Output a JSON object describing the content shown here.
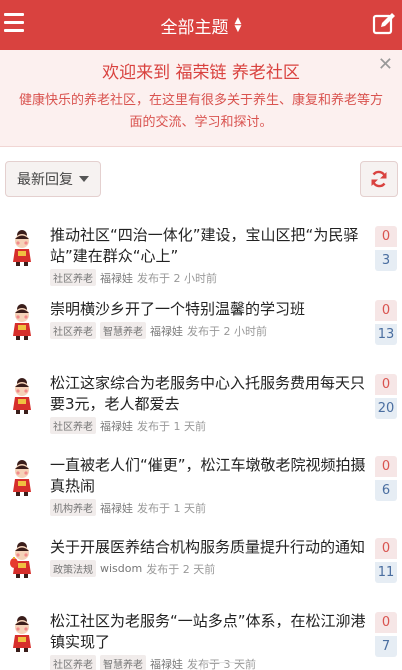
{
  "header": {
    "title": "全部主题"
  },
  "welcome": {
    "heading": "欢迎来到 福荣链 养老社区",
    "description": "健康快乐的养老社区，在这里有很多关于养生、康复和养老等方面的交流、学习和探讨。"
  },
  "toolbar": {
    "sort_label": "最新回复"
  },
  "colors": {
    "brand": "#d9423f",
    "banner_bg": "#fcf0ef"
  },
  "topics": [
    {
      "title": "推动社区“四治一体化”建设，宝山区把“为民驿站”建在群众“心上”",
      "tags": [
        "社区养老"
      ],
      "author": "福禄娃",
      "time": "发布于 2 小时前",
      "likes": "0",
      "replies": "3",
      "avatar": "doll-avatar"
    },
    {
      "title": "崇明横沙乡开了一个特别温馨的学习班",
      "tags": [
        "社区养老",
        "智慧养老"
      ],
      "author": "福禄娃",
      "time": "发布于 2 小时前",
      "likes": "0",
      "replies": "13",
      "avatar": "doll-avatar"
    },
    {
      "title": "松江这家综合为老服务中心入托服务费用每天只要3元，老人都爱去",
      "tags": [
        "社区养老"
      ],
      "author": "福禄娃",
      "time": "发布于 1 天前",
      "likes": "0",
      "replies": "20",
      "avatar": "doll-avatar"
    },
    {
      "title": "一直被老人们“催更”，松江车墩敬老院视频拍摄真热闹",
      "tags": [
        "机构养老"
      ],
      "author": "福禄娃",
      "time": "发布于 1 天前",
      "likes": "0",
      "replies": "6",
      "avatar": "doll-avatar"
    },
    {
      "title": "关于开展医养结合机构服务质量提升行动的通知",
      "tags": [
        "政策法规"
      ],
      "author": "wisdom",
      "time": "发布于 2 天前",
      "likes": "0",
      "replies": "11",
      "avatar": "lantern-doll-avatar"
    },
    {
      "title": "松江社区为老服务“一站多点”体系，在松江泖港镇实现了",
      "tags": [
        "社区养老",
        "智慧养老"
      ],
      "author": "福禄娃",
      "time": "发布于 3 天前",
      "likes": "0",
      "replies": "7",
      "avatar": "doll-avatar"
    }
  ]
}
